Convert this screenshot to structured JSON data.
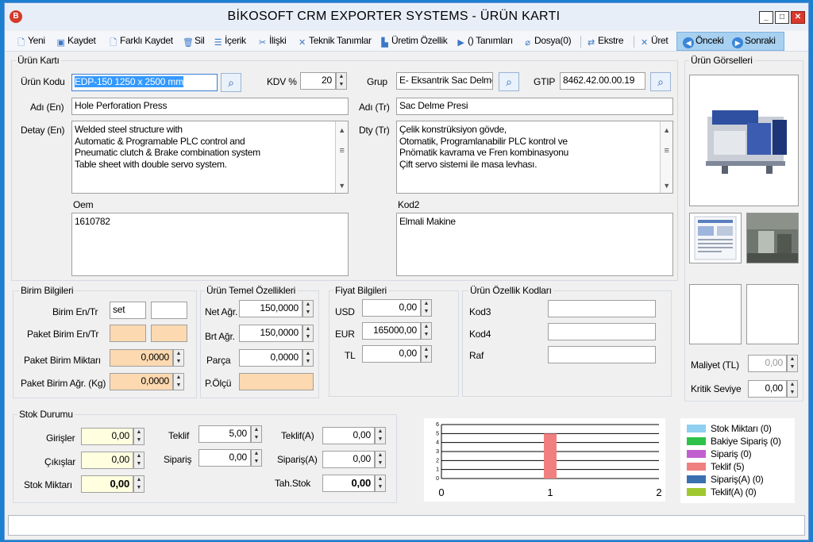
{
  "window": {
    "title": "BİKOSOFT CRM EXPORTER SYSTEMS - ÜRÜN KARTI",
    "min_label": "_",
    "max_label": "□",
    "close_label": "✕"
  },
  "toolbar": {
    "new": "Yeni",
    "save": "Kaydet",
    "save_as": "Farklı Kaydet",
    "delete": "Sil",
    "content": "İçerik",
    "relation": "İlişki",
    "tech": "Teknik Tanımlar",
    "production": "Üretim Özellik",
    "definitions": "() Tanımları",
    "file": "Dosya(0)",
    "statement": "Ekstre",
    "produce": "Üret",
    "prev": "Önceki",
    "next": "Sonraki"
  },
  "product": {
    "section_title": "Ürün Kartı",
    "code_label": "Ürün Kodu",
    "code_value": "EDP-150 1250 x 2500 mm",
    "kdv_label": "KDV %",
    "kdv_value": "20",
    "group_label": "Grup",
    "group_value": "E-  Eksantrik Sac Delme",
    "gtip_label": "GTIP",
    "gtip_value": "8462.42.00.00.19",
    "name_en_label": "Adı (En)",
    "name_en_value": "Hole Perforation Press",
    "name_tr_label": "Adı (Tr)",
    "name_tr_value": "Sac Delme Presi",
    "detail_en_label": "Detay (En)",
    "detail_en_value": "Welded steel structure with\nAutomatic & Programable PLC control and\nPneumatic clutch & Brake combination system\nTable sheet with double servo system.",
    "detail_tr_label": "Dty (Tr)",
    "detail_tr_value": "Çelik konstrüksiyon gövde,\nOtomatik, Programlanabilir PLC kontrol ve\nPnömatik kavrama ve Fren kombinasyonu\nÇift servo sistemi ile masa levhası.",
    "oem_label": "Oem",
    "oem_value": "1610782",
    "kod2_label": "Kod2",
    "kod2_value": "Elmali Makine"
  },
  "images": {
    "section_title": "Ürün Görselleri",
    "cost_label": "Maliyet (TL)",
    "cost_value": "0,00",
    "critical_label": "Kritik Seviye",
    "critical_value": "0,00"
  },
  "unit": {
    "section_title": "Birim Bilgileri",
    "unit_label": "Birim En/Tr",
    "unit_en": "set",
    "unit_tr": "",
    "pkg_unit_label": "Paket Birim En/Tr",
    "pkg_qty_label": "Paket Birim Miktarı",
    "pkg_qty_value": "0,0000",
    "pkg_weight_label": "Paket Birim Ağr. (Kg)",
    "pkg_weight_value": "0,0000"
  },
  "basic": {
    "section_title": "Ürün Temel Özellikleri",
    "net_label": "Net Ağr.",
    "net_value": "150,0000",
    "gross_label": "Brt Ağr.",
    "gross_value": "150,0000",
    "part_label": "Parça",
    "part_value": "0,0000",
    "dim_label": "P.Ölçü"
  },
  "price": {
    "section_title": "Fiyat Bilgileri",
    "usd_label": "USD",
    "usd_value": "0,00",
    "eur_label": "EUR",
    "eur_value": "165000,00",
    "tl_label": "TL",
    "tl_value": "0,00"
  },
  "codes": {
    "section_title": "Ürün Özellik Kodları",
    "kod3_label": "Kod3",
    "kod4_label": "Kod4",
    "raf_label": "Raf"
  },
  "stock": {
    "section_title": "Stok Durumu",
    "in_label": "Girişler",
    "in_value": "0,00",
    "out_label": "Çıkışlar",
    "out_value": "0,00",
    "qty_label": "Stok Miktarı",
    "qty_value": "0,00",
    "offer_label": "Teklif",
    "offer_value": "5,00",
    "order_label": "Sipariş",
    "order_value": "0,00",
    "offer_a_label": "Teklif(A)",
    "offer_a_value": "0,00",
    "order_a_label": "Sipariş(A)",
    "order_a_value": "0,00",
    "tah_label": "Tah.Stok",
    "tah_value": "0,00"
  },
  "chart_data": {
    "type": "bar",
    "x": [
      1
    ],
    "series": [
      {
        "name": "Stok Miktarı (0)",
        "color": "#8fd0f0",
        "values": [
          0
        ]
      },
      {
        "name": "Bakiye Sipariş (0)",
        "color": "#2fc24a",
        "values": [
          0
        ]
      },
      {
        "name": "Sipariş (0)",
        "color": "#c060d0",
        "values": [
          0
        ]
      },
      {
        "name": "Teklif (5)",
        "color": "#f08080",
        "values": [
          5
        ]
      },
      {
        "name": "Sipariş(A) (0)",
        "color": "#3a70b0",
        "values": [
          0
        ]
      },
      {
        "name": "Teklif(A) (0)",
        "color": "#a0c830",
        "values": [
          0
        ]
      }
    ],
    "xlim": [
      0,
      2
    ],
    "xticks": [
      "0",
      "1",
      "2"
    ],
    "ylim": [
      0,
      6
    ],
    "yticks": [
      "0",
      "1",
      "2",
      "3",
      "4",
      "5",
      "6"
    ],
    "grid": true,
    "legend": "right"
  }
}
